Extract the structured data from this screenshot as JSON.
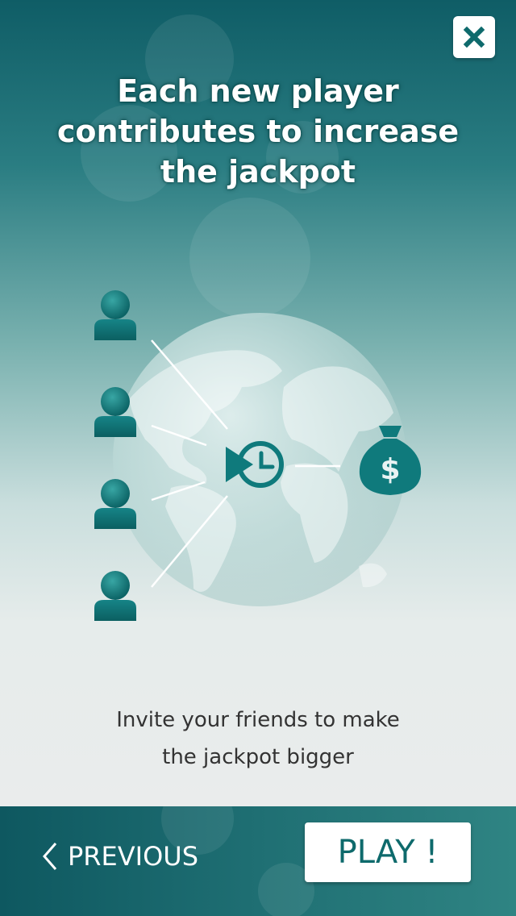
{
  "headline": "Each new player\ncontributes to increase\nthe jackpot",
  "caption": "Invite your friends to make\nthe jackpot bigger",
  "footer": {
    "previous_label": "PREVIOUS",
    "play_label": "PLAY !"
  },
  "money_bag_symbol": "$",
  "colors": {
    "accent_teal": "#0e6a6c",
    "icon_teal": "#0f7a7c",
    "dark_teal": "#0e5860"
  },
  "icons": [
    "close-icon",
    "user-icon",
    "clock-icon",
    "money-bag-icon",
    "chevron-left-icon"
  ]
}
